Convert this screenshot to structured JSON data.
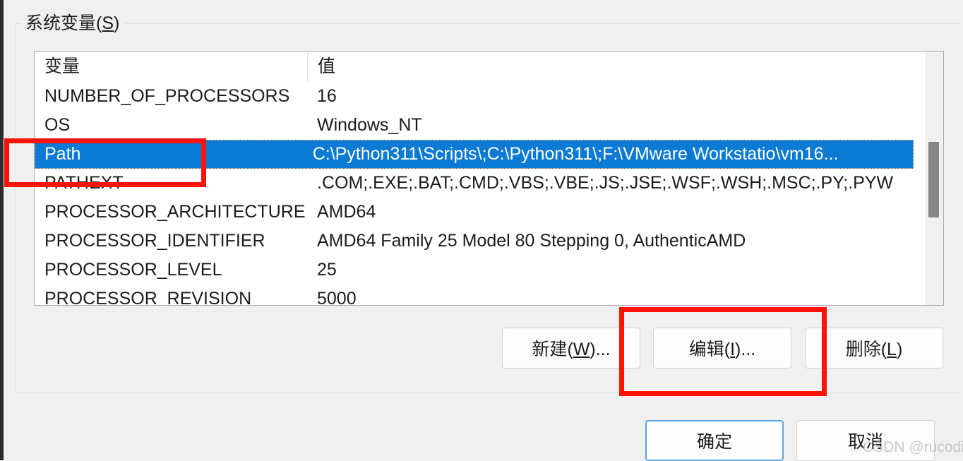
{
  "window": {
    "background_color": "#f0f0f0",
    "frame_color": "#2b2b2b"
  },
  "group_box": {
    "label_prefix": "系统变量(",
    "label_mnemonic": "S",
    "label_suffix": ")"
  },
  "table": {
    "columns": [
      "变量",
      "值"
    ],
    "selected_row_index": 2,
    "selection_color": "#0a7ad4",
    "rows": [
      {
        "name": "NUMBER_OF_PROCESSORS",
        "value": "16"
      },
      {
        "name": "OS",
        "value": "Windows_NT"
      },
      {
        "name": "Path",
        "value": "C:\\Python311\\Scripts\\;C:\\Python311\\;F:\\VMware Workstatio\\vm16..."
      },
      {
        "name": "PATHEXT",
        "value": ".COM;.EXE;.BAT;.CMD;.VBS;.VBE;.JS;.JSE;.WSF;.WSH;.MSC;.PY;.PYW"
      },
      {
        "name": "PROCESSOR_ARCHITECTURE",
        "value": "AMD64"
      },
      {
        "name": "PROCESSOR_IDENTIFIER",
        "value": "AMD64 Family 25 Model 80 Stepping 0, AuthenticAMD"
      },
      {
        "name": "PROCESSOR_LEVEL",
        "value": "25"
      },
      {
        "name": "PROCESSOR_REVISION",
        "value": "5000"
      }
    ]
  },
  "buttons": {
    "new": {
      "prefix": "新建(",
      "mnemonic": "W",
      "suffix": ")..."
    },
    "edit": {
      "prefix": "编辑(",
      "mnemonic": "I",
      "suffix": ")..."
    },
    "delete": {
      "prefix": "删除(",
      "mnemonic": "L",
      "suffix": ")"
    },
    "ok": {
      "label": "确定"
    },
    "cancel": {
      "label": "取消"
    }
  },
  "annotations": {
    "color": "#fc1303",
    "highlight_path_row": "Path",
    "highlight_edit_button": "编辑(I)..."
  },
  "watermark": {
    "text": "CSDN @rucoding"
  }
}
